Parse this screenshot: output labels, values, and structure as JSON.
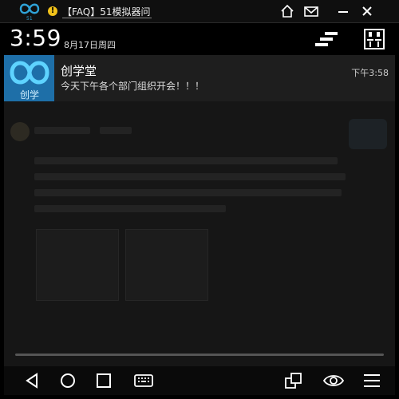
{
  "window": {
    "title": "【FAQ】51模拟器问",
    "controls": [
      "home-icon",
      "mail-icon",
      "minimize-icon",
      "close-icon"
    ]
  },
  "status_bar": {
    "time": "3:59",
    "date": "8月17日周四"
  },
  "notification": {
    "app_name": "创学堂",
    "message": "今天下午各个部门组织开会！！！",
    "time": "下午3:58",
    "icon_color": "#1e6fa8"
  },
  "navigation": {
    "buttons": [
      "back-icon",
      "home-icon",
      "recents-icon",
      "keyboard-icon",
      "screen-rotate-icon",
      "eye-icon",
      "menu-icon"
    ]
  },
  "colors": {
    "accent": "#1e6fa8",
    "warning": "#f2c21a",
    "logo": "#2fa3d8"
  }
}
